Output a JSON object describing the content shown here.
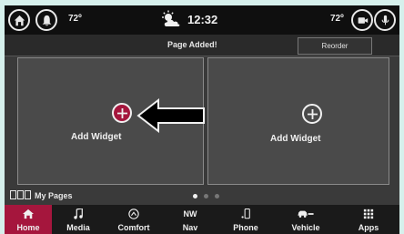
{
  "status": {
    "temp_left": "72º",
    "temp_right": "72º",
    "time": "12:32"
  },
  "notice": {
    "message": "Page Added!",
    "reorder_label": "Reorder"
  },
  "widgets": {
    "left_label": "Add Widget",
    "right_label": "Add Widget"
  },
  "pages": {
    "label": "My Pages",
    "dots": [
      {
        "color": "#f0f0f0"
      },
      {
        "color": "#777777"
      },
      {
        "color": "#777777"
      }
    ]
  },
  "nav": {
    "items": [
      {
        "label": "Home",
        "icon": "home-icon",
        "active": true
      },
      {
        "label": "Media",
        "icon": "music-note-icon",
        "active": false
      },
      {
        "label": "Comfort",
        "icon": "comfort-icon",
        "active": false
      },
      {
        "label": "Nav",
        "icon": "compass-icon",
        "active": false,
        "icon_text": "NW"
      },
      {
        "label": "Phone",
        "icon": "phone-icon",
        "active": false
      },
      {
        "label": "Vehicle",
        "icon": "vehicle-icon",
        "active": false
      },
      {
        "label": "Apps",
        "icon": "apps-grid-icon",
        "active": false
      }
    ]
  },
  "colors": {
    "accent": "#a5163d",
    "background": "#3a3a3a",
    "border": "#d6f0ec"
  }
}
